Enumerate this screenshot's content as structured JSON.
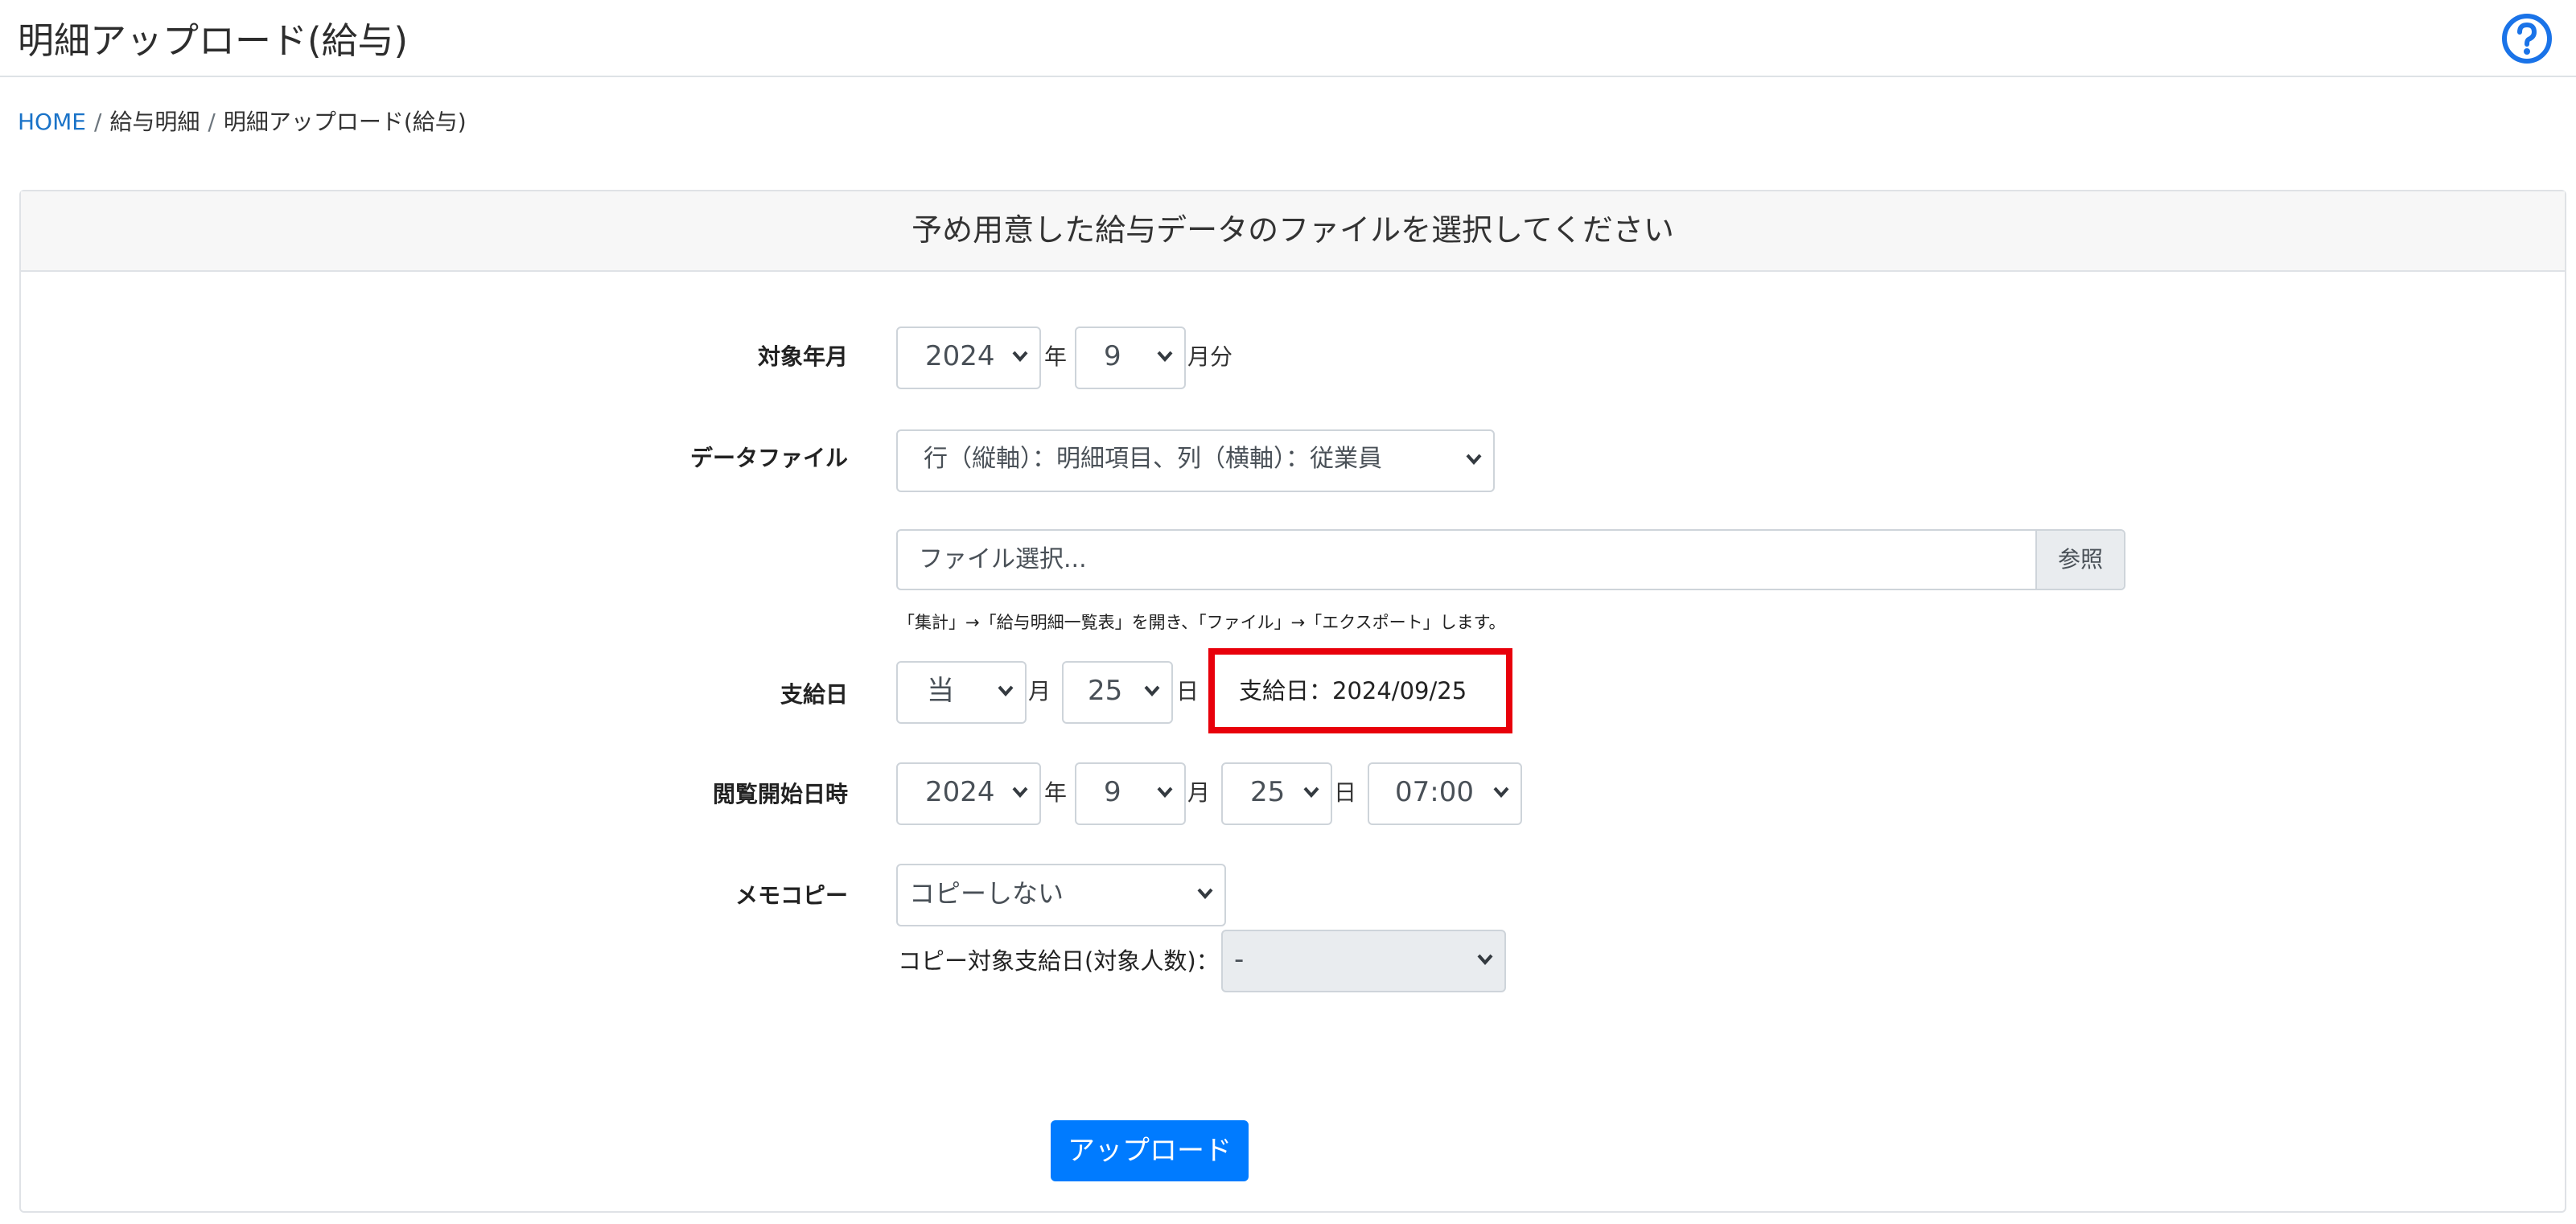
{
  "header": {
    "title": "明細アップロード(給与)",
    "help_icon": "question-circle-icon"
  },
  "breadcrumb": {
    "home": "HOME",
    "parent": "給与明細",
    "current": "明細アップロード(給与)",
    "separator": "/"
  },
  "card": {
    "heading": "予め用意した給与データのファイルを選択してください"
  },
  "target_month": {
    "label": "対象年月",
    "year_value": "2024",
    "year_unit": "年",
    "month_value": "9",
    "month_unit": "月分"
  },
  "data_file": {
    "label": "データファイル",
    "format_value": "行（縦軸）：明細項目、列（横軸）：従業員",
    "file_placeholder": "ファイル選択...",
    "browse_label": "参照",
    "hint": "「集計」→「給与明細一覧表」を開き、「ファイル」→「エクスポート」します。"
  },
  "pay_day": {
    "label": "支給日",
    "month_value": "当",
    "month_unit": "月",
    "day_value": "25",
    "day_unit": "日",
    "summary": "支給日：2024/09/25"
  },
  "view_start": {
    "label": "閲覧開始日時",
    "year_value": "2024",
    "year_unit": "年",
    "month_value": "9",
    "month_unit": "月",
    "day_value": "25",
    "day_unit": "日",
    "time_value": "07:00"
  },
  "memo_copy": {
    "label": "メモコピー",
    "value": "コピーしない",
    "target_label": "コピー対象支給日(対象人数)：",
    "target_value": "-"
  },
  "upload_button": "アップロード",
  "colors": {
    "accent": "#007bff",
    "link": "#1a73c8",
    "highlight": "#e8000b"
  }
}
